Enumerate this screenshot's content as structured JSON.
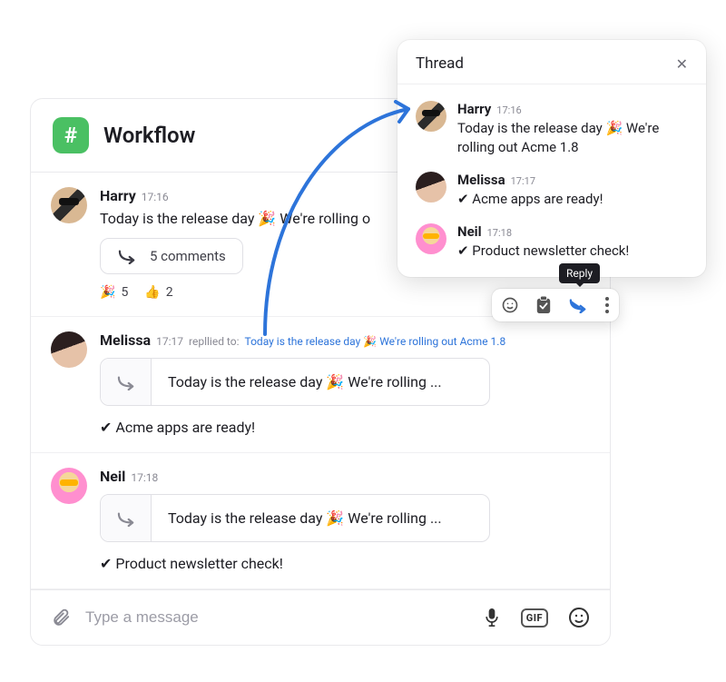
{
  "channel": {
    "name": "Workflow",
    "icon": "#"
  },
  "messages": [
    {
      "sender": "Harry",
      "time": "17:16",
      "text": "Today is the release day 🎉 We're rolling o",
      "comments_label": "5 comments",
      "reactions": [
        {
          "emoji": "🎉",
          "count": "5"
        },
        {
          "emoji": "👍",
          "count": "2"
        }
      ]
    },
    {
      "sender": "Melissa",
      "time": "17:17",
      "replied_label": "repllied to:",
      "replied_to": "Today is the release day 🎉 We're rolling out Acme 1.8",
      "quote": "Today is the release day 🎉 We're rolling ...",
      "reply_text": "✔ Acme apps are ready!"
    },
    {
      "sender": "Neil",
      "time": "17:18",
      "quote": "Today is the release day 🎉 We're rolling ...",
      "reply_text": "✔ Product newsletter check!"
    }
  ],
  "composer": {
    "placeholder": "Type a message",
    "gif_label": "GIF"
  },
  "thread": {
    "title": "Thread",
    "items": [
      {
        "sender": "Harry",
        "time": "17:16",
        "text": "Today is the release day 🎉 We're rolling out Acme 1.8"
      },
      {
        "sender": "Melissa",
        "time": "17:17",
        "text": "✔ Acme apps are ready!"
      },
      {
        "sender": "Neil",
        "time": "17:18",
        "text": "✔ Product newsletter check!"
      }
    ]
  },
  "tooltip": {
    "reply": "Reply"
  }
}
